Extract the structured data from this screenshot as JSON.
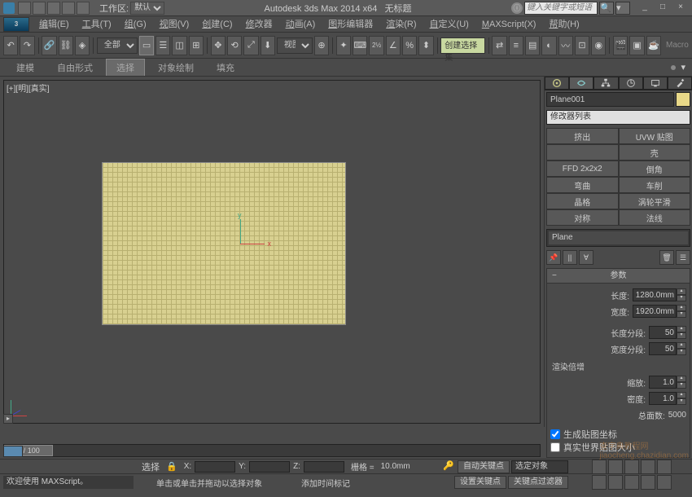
{
  "title": {
    "app": "Autodesk 3ds Max 2014 x64",
    "doc": "无标题",
    "workspace_lbl": "工作区:",
    "workspace_val": "默认",
    "search_placeholder": "键入关键字或短语"
  },
  "menu": {
    "items": [
      "编辑(E)",
      "工具(T)",
      "组(G)",
      "视图(V)",
      "创建(C)",
      "修改器",
      "动画(A)",
      "图形编辑器",
      "渲染(R)",
      "自定义(U)",
      "MAXScript(X)",
      "帮助(H)"
    ],
    "highlighted": "创建选择集"
  },
  "toolbar": {
    "dd_all": "全部",
    "dd_view": "视图",
    "macro": "Macro"
  },
  "ribbon": {
    "tabs": [
      "建模",
      "自由形式",
      "选择",
      "对象绘制",
      "填充"
    ],
    "active_idx": 2
  },
  "viewport": {
    "label": "[+][明][真实]"
  },
  "cmd": {
    "obj_name": "Plane001",
    "mod_list": "修改器列表",
    "mod_buttons": [
      [
        "挤出",
        "UVW 贴图"
      ],
      [
        "",
        "壳"
      ],
      [
        "FFD 2x2x2",
        "倒角"
      ],
      [
        "弯曲",
        "车削"
      ],
      [
        "晶格",
        "涡轮平滑"
      ],
      [
        "对称",
        "法线"
      ]
    ],
    "stack_item": "Plane",
    "params_hdr": "参数",
    "length_lbl": "长度:",
    "length_val": "1280.0mm",
    "width_lbl": "宽度:",
    "width_val": "1920.0mm",
    "lsegs_lbl": "长度分段:",
    "lsegs_val": "50",
    "wsegs_lbl": "宽度分段:",
    "wsegs_val": "50",
    "render_hdr": "渲染倍增",
    "scale_lbl": "缩放:",
    "scale_val": "1.0",
    "density_lbl": "密度:",
    "density_val": "1.0",
    "total_lbl": "总面数:",
    "total_val": "5000",
    "gen_map": "生成贴图坐标",
    "real_world": "真实世界贴图大小"
  },
  "status": {
    "welcome": "欢迎使用 MAXScript。",
    "sel_lbl": "选择",
    "x_lbl": "X:",
    "y_lbl": "Y:",
    "z_lbl": "Z:",
    "grid_lbl": "栅格 =",
    "grid_val": "10.0mm",
    "autokey": "自动关键点",
    "selected": "选定对象",
    "setkey": "设置关键点",
    "keyfilter": "关键点过滤器",
    "prompt": "单击或单击并拖动以选择对象",
    "add_marker": "添加时间标记",
    "timeslider": "0 / 100"
  }
}
